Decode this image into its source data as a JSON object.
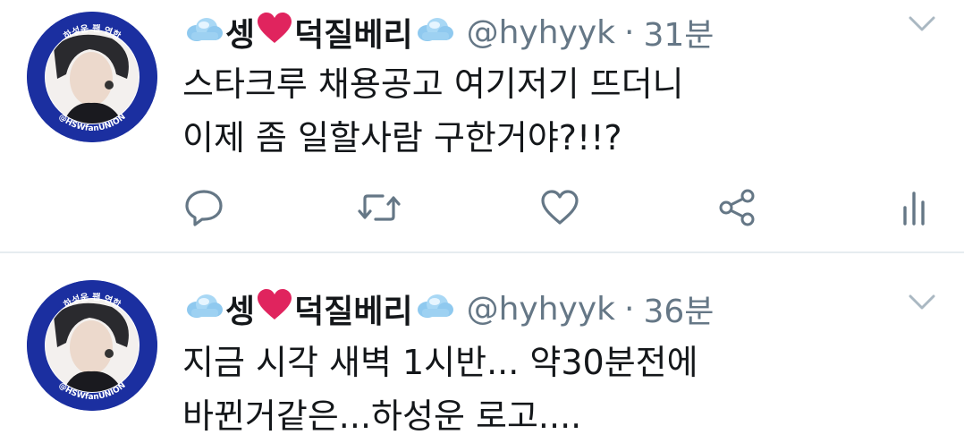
{
  "colors": {
    "text": "#14171a",
    "secondary": "#657786",
    "divider": "#e6ecf0",
    "heart": "#e0245e",
    "avatar_ring": "#1b2fa0"
  },
  "tweets": [
    {
      "display_name_a": "셍",
      "display_name_b": "덕질베리",
      "handle": "@hyhyyk",
      "separator": "·",
      "time": "31분",
      "lines": [
        "스타크루 채용공고 여기저기 뜨더니",
        "이제 좀 일할사람 구한거야?!!?"
      ],
      "avatar_text_top": "하성운 팬 연합",
      "avatar_text_bottom": "@HSWfanUNION"
    },
    {
      "display_name_a": "셍",
      "display_name_b": "덕질베리",
      "handle": "@hyhyyk",
      "separator": "·",
      "time": "36분",
      "lines": [
        "지금 시각 새벽 1시반...  약30분전에",
        "바뀐거같은...하성운 로고...."
      ],
      "avatar_text_top": "하성운 팬 연합",
      "avatar_text_bottom": "@HSWfanUNION"
    }
  ],
  "icons": {
    "cloud": "cloud-icon",
    "heart": "heart-icon",
    "reply": "reply-icon",
    "retweet": "retweet-icon",
    "like": "like-icon",
    "share": "share-icon",
    "analytics": "analytics-icon",
    "caret": "chevron-down-icon"
  }
}
